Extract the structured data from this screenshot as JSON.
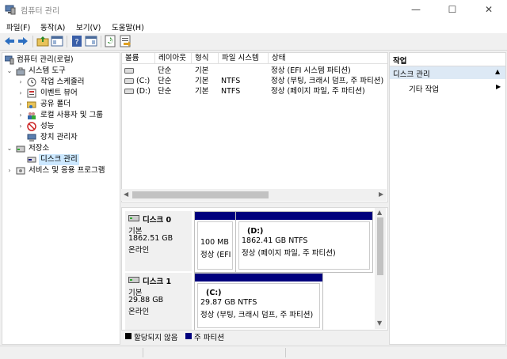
{
  "window": {
    "title": "컴퓨터 관리",
    "minimize": "—",
    "maximize": "☐",
    "close": "✕"
  },
  "menu": [
    "파일(F)",
    "동작(A)",
    "보기(V)",
    "도움말(H)"
  ],
  "tree": {
    "root": "컴퓨터 관리(로컬)",
    "system_tools": "시스템 도구",
    "task_scheduler": "작업 스케줄러",
    "event_viewer": "이벤트 뷰어",
    "shared_folders": "공유 폴더",
    "local_users": "로컬 사용자 및 그룹",
    "performance": "성능",
    "device_manager": "장치 관리자",
    "storage": "저장소",
    "disk_management": "디스크 관리",
    "services": "서비스 및 응용 프로그램"
  },
  "volumes": {
    "headers": [
      "볼륨",
      "레이아웃",
      "형식",
      "파일 시스템",
      "상태"
    ],
    "rows": [
      {
        "volume": "",
        "layout": "단순",
        "type": "기본",
        "fs": "",
        "status": "정상 (EFI 시스템 파티션)"
      },
      {
        "volume": "(C:)",
        "layout": "단순",
        "type": "기본",
        "fs": "NTFS",
        "status": "정상 (부팅, 크래시 덤프, 주 파티션)"
      },
      {
        "volume": "(D:)",
        "layout": "단순",
        "type": "기본",
        "fs": "NTFS",
        "status": "정상 (페이지 파일, 주 파티션)"
      }
    ]
  },
  "disks": [
    {
      "name": "디스크 0",
      "kind": "기본",
      "size": "1862.51 GB",
      "state": "온라인",
      "partitions": [
        {
          "label": "",
          "size": "100 MB",
          "status": "정상 (EFI 시"
        },
        {
          "label": "(D:)",
          "size": "1862.41 GB NTFS",
          "status": "정상 (페이지 파일, 주 파티션)"
        }
      ]
    },
    {
      "name": "디스크 1",
      "kind": "기본",
      "size": "29.88 GB",
      "state": "온라인",
      "partitions": [
        {
          "label": "(C:)",
          "size": "29.87 GB NTFS",
          "status": "정상 (부팅, 크래시 덤프, 주 파티션)"
        }
      ]
    }
  ],
  "legend": {
    "unallocated": "할당되지 않음",
    "primary": "주 파티션"
  },
  "actions": {
    "header": "작업",
    "section": "디스크 관리",
    "more": "기타 작업"
  },
  "colors": {
    "primary_partition": "#00007d",
    "unallocated": "#000000",
    "selection": "#cce8ff",
    "action_section": "#dde9f5"
  }
}
